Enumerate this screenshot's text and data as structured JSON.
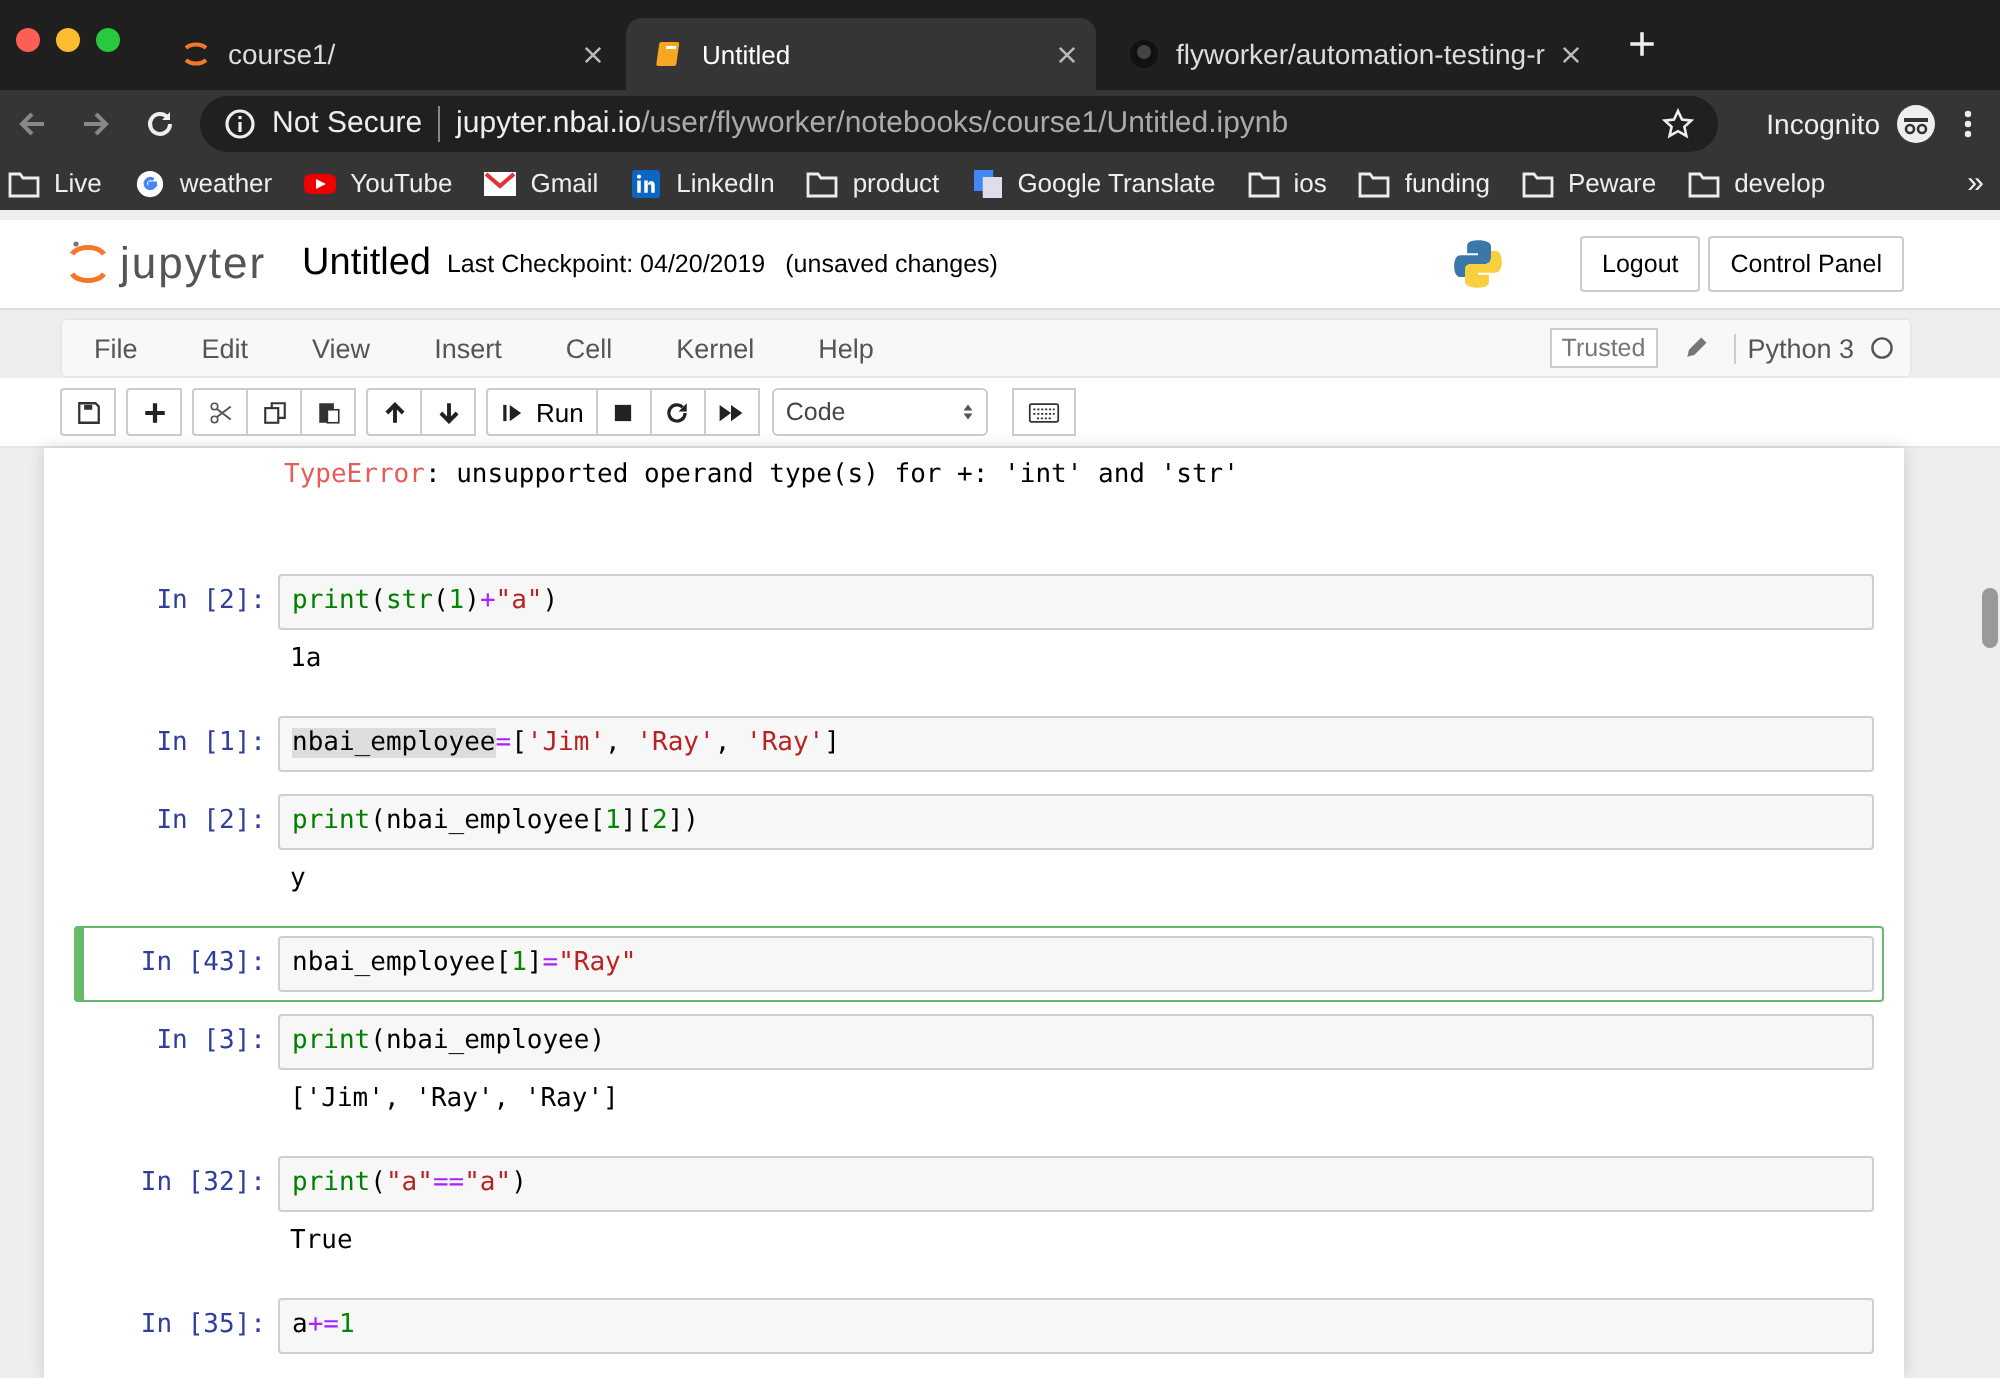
{
  "browser": {
    "tabs": [
      {
        "title": "course1/",
        "kind": "jupyter",
        "selected": false
      },
      {
        "title": "Untitled",
        "kind": "notebook",
        "selected": true
      },
      {
        "title": "flyworker/automation-testing-r",
        "kind": "github",
        "selected": false
      }
    ],
    "new_tab": "+",
    "address": {
      "security": "Not Secure",
      "host": "jupyter.nbai.io",
      "path": "/user/flyworker/notebooks/course1/Untitled.ipynb"
    },
    "profile": "Incognito",
    "bookmarks": [
      {
        "label": "Live",
        "kind": "folder"
      },
      {
        "label": "weather",
        "kind": "google"
      },
      {
        "label": "YouTube",
        "kind": "youtube"
      },
      {
        "label": "Gmail",
        "kind": "gmail"
      },
      {
        "label": "LinkedIn",
        "kind": "linkedin"
      },
      {
        "label": "product",
        "kind": "folder"
      },
      {
        "label": "Google Translate",
        "kind": "translate"
      },
      {
        "label": "ios",
        "kind": "folder"
      },
      {
        "label": "funding",
        "kind": "folder"
      },
      {
        "label": "Peware",
        "kind": "folder"
      },
      {
        "label": "develop",
        "kind": "folder"
      }
    ],
    "bookmarks_more": "»"
  },
  "header": {
    "logo": "jupyter",
    "title": "Untitled",
    "checkpoint": "Last Checkpoint: 04/20/2019",
    "autosave": "(unsaved changes)",
    "buttons": [
      "Logout",
      "Control Panel"
    ]
  },
  "menu": {
    "items": [
      "File",
      "Edit",
      "View",
      "Insert",
      "Cell",
      "Kernel",
      "Help"
    ],
    "trusted": "Trusted",
    "kernel": "Python 3"
  },
  "toolbar": {
    "groups": [
      [
        {
          "kind": "save"
        }
      ],
      [
        {
          "kind": "plus"
        }
      ],
      [
        {
          "kind": "cut"
        },
        {
          "kind": "copy"
        },
        {
          "kind": "paste"
        }
      ],
      [
        {
          "kind": "up"
        },
        {
          "kind": "down"
        }
      ],
      [
        {
          "kind": "run",
          "label": "Run"
        },
        {
          "kind": "stop"
        },
        {
          "kind": "restart"
        },
        {
          "kind": "fast-forward"
        }
      ]
    ],
    "cell_type": "Code"
  },
  "error_output": [
    {
      "kind": "error",
      "text": "TypeError"
    },
    {
      "kind": "plain",
      "text": ": unsupported operand type(s) for +: 'int' and 'str'"
    }
  ],
  "cells": [
    {
      "prompt": "In [2]:",
      "selected": false,
      "code": [
        {
          "kind": "builtin",
          "text": "print"
        },
        {
          "kind": "plain",
          "text": "("
        },
        {
          "kind": "builtin",
          "text": "str"
        },
        {
          "kind": "plain",
          "text": "("
        },
        {
          "kind": "number",
          "text": "1"
        },
        {
          "kind": "plain",
          "text": ")"
        },
        {
          "kind": "operator",
          "text": "+"
        },
        {
          "kind": "string",
          "text": "\"a\""
        },
        {
          "kind": "plain",
          "text": ")"
        }
      ],
      "output": "1a"
    },
    {
      "prompt": "In [1]:",
      "selected": false,
      "code": [
        {
          "kind": "match",
          "text": "nbai_employee"
        },
        {
          "kind": "operator",
          "text": "="
        },
        {
          "kind": "plain",
          "text": "["
        },
        {
          "kind": "string",
          "text": "'Jim'"
        },
        {
          "kind": "plain",
          "text": ", "
        },
        {
          "kind": "string",
          "text": "'Ray'"
        },
        {
          "kind": "plain",
          "text": ", "
        },
        {
          "kind": "string",
          "text": "'Ray'"
        },
        {
          "kind": "plain",
          "text": "]"
        }
      ]
    },
    {
      "prompt": "In [2]:",
      "selected": false,
      "code": [
        {
          "kind": "builtin",
          "text": "print"
        },
        {
          "kind": "plain",
          "text": "(nbai_employee["
        },
        {
          "kind": "number",
          "text": "1"
        },
        {
          "kind": "plain",
          "text": "]["
        },
        {
          "kind": "number",
          "text": "2"
        },
        {
          "kind": "plain",
          "text": "])"
        }
      ],
      "output": "y"
    },
    {
      "prompt": "In [43]:",
      "selected": true,
      "code": [
        {
          "kind": "plain",
          "text": "nbai_employee["
        },
        {
          "kind": "number",
          "text": "1"
        },
        {
          "kind": "plain",
          "text": "]"
        },
        {
          "kind": "operator",
          "text": "="
        },
        {
          "kind": "string",
          "text": "\"Ray\""
        }
      ]
    },
    {
      "prompt": "In [3]:",
      "selected": false,
      "code": [
        {
          "kind": "builtin",
          "text": "print"
        },
        {
          "kind": "plain",
          "text": "(nbai_employee)"
        }
      ],
      "output": "['Jim', 'Ray', 'Ray']"
    },
    {
      "prompt": "In [32]:",
      "selected": false,
      "code": [
        {
          "kind": "builtin",
          "text": "print"
        },
        {
          "kind": "plain",
          "text": "("
        },
        {
          "kind": "string",
          "text": "\"a\""
        },
        {
          "kind": "operator",
          "text": "=="
        },
        {
          "kind": "string",
          "text": "\"a\""
        },
        {
          "kind": "plain",
          "text": ")"
        }
      ],
      "output": "True"
    },
    {
      "prompt": "In [35]:",
      "selected": false,
      "code": [
        {
          "kind": "plain",
          "text": "a"
        },
        {
          "kind": "operator",
          "text": "+="
        },
        {
          "kind": "number",
          "text": "1"
        }
      ]
    }
  ]
}
